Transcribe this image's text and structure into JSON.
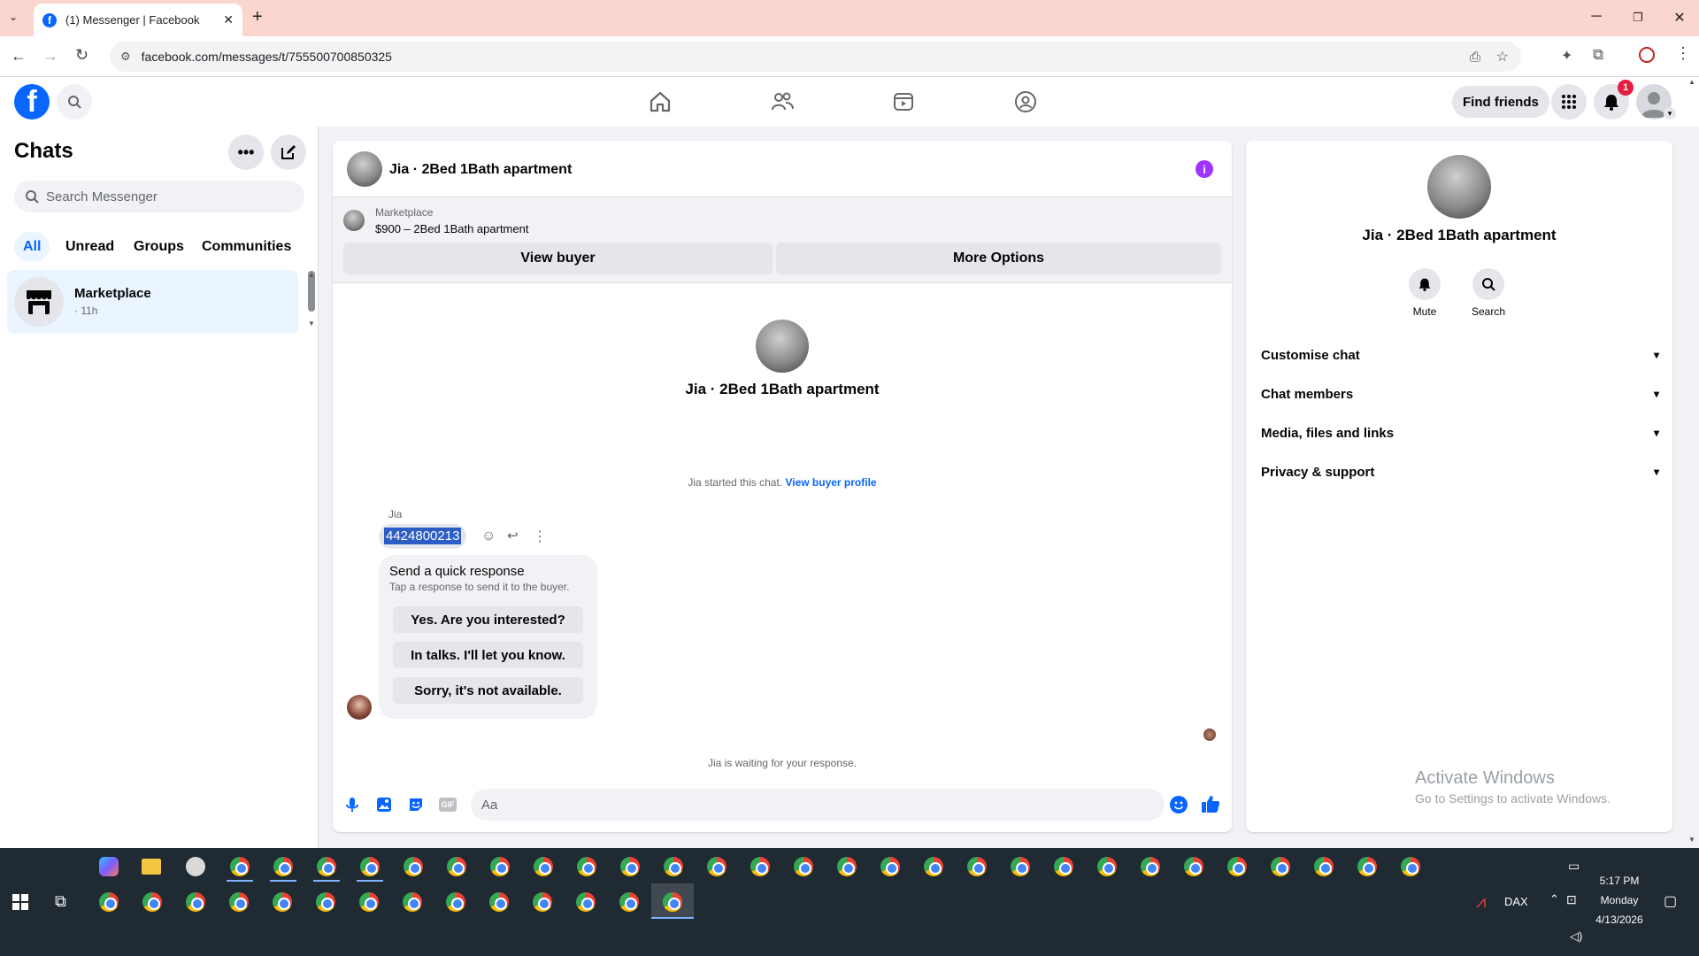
{
  "browser": {
    "tab_title": "(1) Messenger | Facebook",
    "url": "facebook.com/messages/t/755500700850325"
  },
  "header": {
    "find_friends": "Find friends",
    "notification_count": "1"
  },
  "sidebar": {
    "title": "Chats",
    "search_placeholder": "Search Messenger",
    "filters": [
      "All",
      "Unread",
      "Groups",
      "Communities"
    ],
    "chat": {
      "name": "Marketplace",
      "time": "· 11h"
    }
  },
  "conversation": {
    "title": "Jia · 2Bed 1Bath apartment",
    "marketplace_label": "Marketplace",
    "listing": "$900 – 2Bed 1Bath apartment",
    "view_buyer": "View buyer",
    "more_options": "More Options",
    "intro_name": "Jia · 2Bed 1Bath apartment",
    "started_text": "Jia started this chat.",
    "view_profile": "View buyer profile",
    "sender": "Jia",
    "message": "4424800213",
    "quick_title": "Send a quick response",
    "quick_sub": "Tap a response to send it to the buyer.",
    "quick_responses": [
      "Yes. Are you interested?",
      "In talks. I'll let you know.",
      "Sorry, it's not available."
    ],
    "waiting": "Jia is waiting for your response.",
    "composer_placeholder": "Aa"
  },
  "details": {
    "name": "Jia · 2Bed 1Bath apartment",
    "mute": "Mute",
    "search": "Search",
    "sections": [
      "Customise chat",
      "Chat members",
      "Media, files and links",
      "Privacy & support"
    ]
  },
  "watermark": {
    "line1": "Activate Windows",
    "line2": "Go to Settings to activate Windows."
  },
  "taskbar": {
    "dax": "DAX",
    "time": "5:17 PM",
    "day": "Monday",
    "date": "4/13/2026"
  },
  "colors": {
    "fb_blue": "#0866ff",
    "accent_purple": "#a033ff",
    "tab_bar": "#fad6ce",
    "taskbar": "#1f2a32"
  }
}
